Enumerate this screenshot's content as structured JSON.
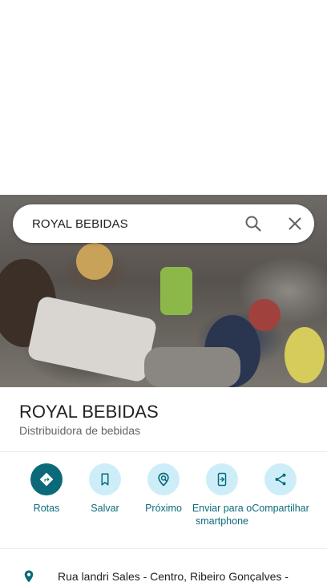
{
  "search": {
    "query": "ROYAL BEBIDAS"
  },
  "place": {
    "name": "ROYAL BEBIDAS",
    "category": "Distribuidora de bebidas",
    "photo_icon": "venue-photo"
  },
  "actions": [
    {
      "label": "Rotas",
      "icon": "directions-icon"
    },
    {
      "label": "Salvar",
      "icon": "bookmark-icon"
    },
    {
      "label": "Próximo",
      "icon": "nearby-icon"
    },
    {
      "label": "Enviar para o smartphone",
      "icon": "send-to-phone-icon"
    },
    {
      "label": "Compartilhar",
      "icon": "share-icon"
    }
  ],
  "address": {
    "text": "Rua landri Sales - Centro, Ribeiro Gonçalves -",
    "icon": "location-pin-icon"
  },
  "colors": {
    "accent": "#0b6a7a",
    "accent_light": "#cdeef8",
    "text_primary": "#202124",
    "text_secondary": "#5f6368"
  }
}
